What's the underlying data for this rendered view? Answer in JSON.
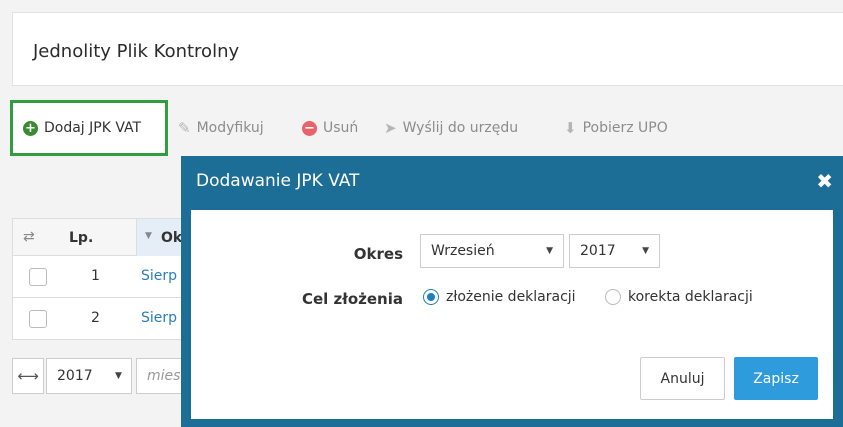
{
  "panel": {
    "title": "Jednolity Plik Kontrolny"
  },
  "toolbar": {
    "add_label": "Dodaj JPK VAT",
    "modify_label": "Modyfikuj",
    "delete_label": "Usuń",
    "send_label": "Wyślij do urzędu",
    "upo_label": "Pobierz UPO"
  },
  "table": {
    "col_lp": "Lp.",
    "col_okres": "Ok",
    "rows": [
      {
        "lp": "1",
        "okres": "Sierp"
      },
      {
        "lp": "2",
        "okres": "Sierp"
      }
    ]
  },
  "filter": {
    "year": "2017",
    "month_placeholder": "mies"
  },
  "modal": {
    "title": "Dodawanie JPK VAT",
    "close_icon": "close-icon",
    "okres_label": "Okres",
    "month_value": "Wrzesień",
    "year_value": "2017",
    "cel_label": "Cel złożenia",
    "option_1": "złożenie deklaracji",
    "option_1_selected": true,
    "option_2": "korekta deklaracji",
    "cancel_label": "Anuluj",
    "save_label": "Zapisz"
  },
  "colors": {
    "modal_header": "#1d6e97",
    "save_button": "#2e9bdd",
    "add_highlight": "#2e9e3f",
    "link": "#2a7db8"
  }
}
